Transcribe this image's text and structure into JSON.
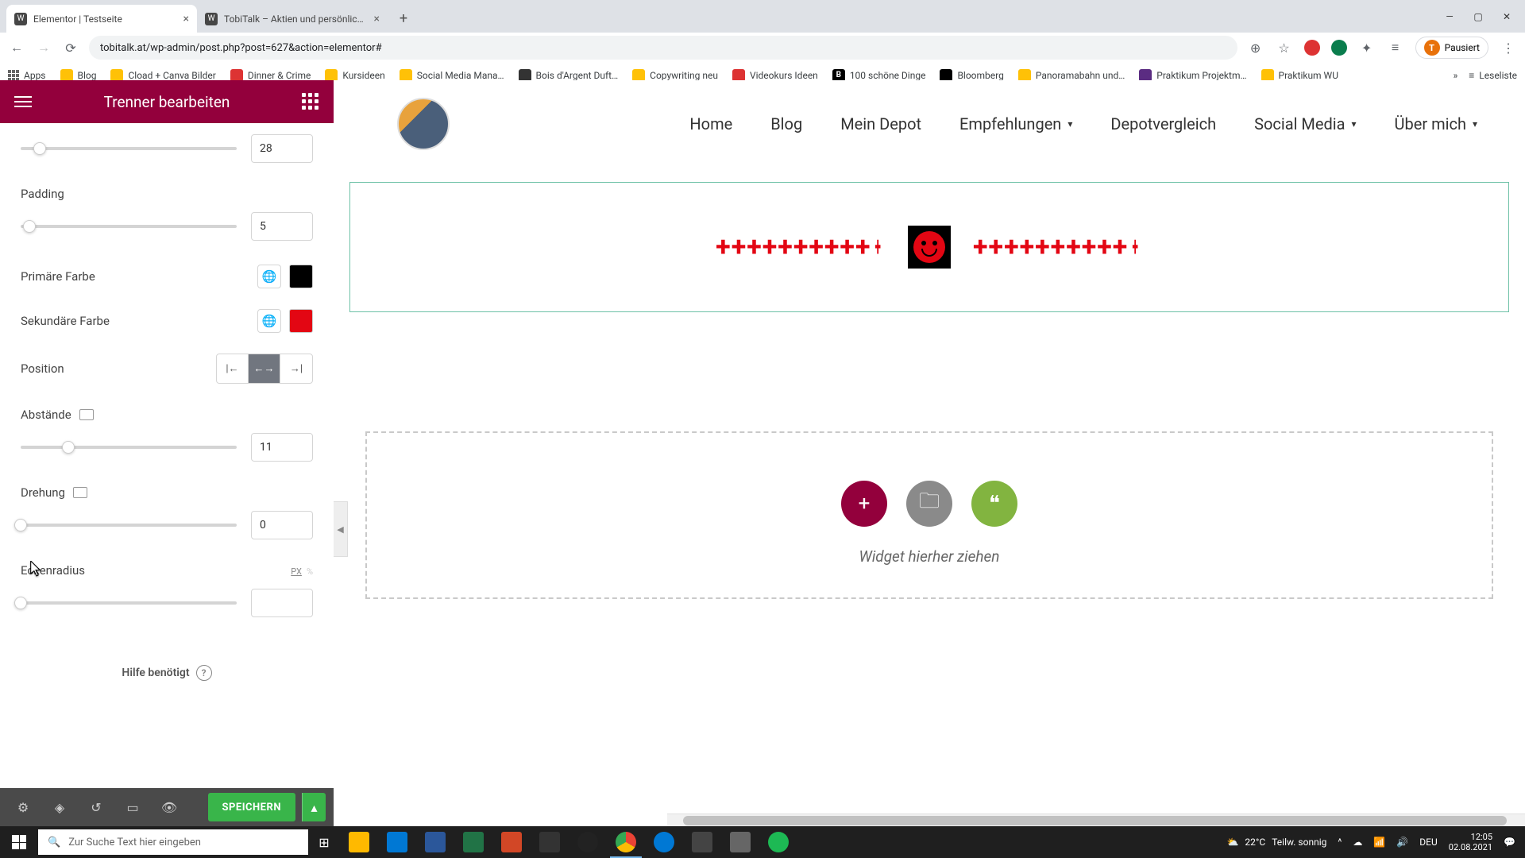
{
  "browser": {
    "tabs": [
      {
        "title": "Elementor | Testseite",
        "active": true
      },
      {
        "title": "TobiTalk – Aktien und persönlich…",
        "active": false
      }
    ],
    "url": "tobitalk.at/wp-admin/post.php?post=627&action=elementor#",
    "avatar_label": "Pausiert",
    "avatar_initial": "T",
    "bookmarks": [
      "Apps",
      "Blog",
      "Cload + Canva Bilder",
      "Dinner & Crime",
      "Kursideen",
      "Social Media Mana…",
      "Bois d'Argent Duft…",
      "Copywriting neu",
      "Videokurs Ideen",
      "100 schöne Dinge",
      "Bloomberg",
      "Panoramabahn und…",
      "Praktikum Projektm…",
      "Praktikum WU"
    ],
    "reading_list": "Leseliste"
  },
  "sidebar": {
    "title": "Trenner bearbeiten",
    "controls": {
      "size_value": "28",
      "padding_label": "Padding",
      "padding_value": "5",
      "primary_label": "Primäre Farbe",
      "primary_color": "#000000",
      "secondary_label": "Sekundäre Farbe",
      "secondary_color": "#e30613",
      "position_label": "Position",
      "spacing_label": "Abstände",
      "spacing_value": "11",
      "rotation_label": "Drehung",
      "rotation_value": "0",
      "radius_label": "Eckenradius",
      "radius_unit": "PX",
      "radius_value": ""
    },
    "help_label": "Hilfe benötigt",
    "save_label": "SPEICHERN"
  },
  "preview": {
    "nav": [
      "Home",
      "Blog",
      "Mein Depot",
      "Empfehlungen",
      "Depotvergleich",
      "Social Media",
      "Über mich"
    ],
    "dropzone_text": "Widget hierher ziehen"
  },
  "taskbar": {
    "search_placeholder": "Zur Suche Text hier eingeben",
    "weather_temp": "22°C",
    "weather_desc": "Teilw. sonnig",
    "lang": "DEU",
    "time": "12:05",
    "date": "02.08.2021"
  }
}
